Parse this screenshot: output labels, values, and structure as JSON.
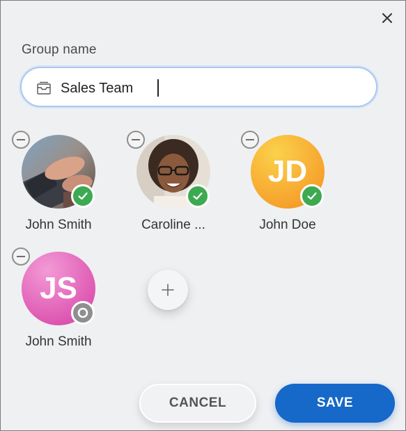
{
  "dialog": {
    "close_icon": "close-icon",
    "group_name_label": "Group name",
    "group_name_value": "Sales Team",
    "group_name_icon": "group-inbox-icon"
  },
  "members": [
    {
      "name": "John Smith",
      "avatar": "photo",
      "status": "accepted",
      "status_icon": "check-icon"
    },
    {
      "name": "Caroline ...",
      "avatar": "photo",
      "status": "accepted",
      "status_icon": "check-icon"
    },
    {
      "name": "John Doe",
      "avatar": "initials",
      "initials": "JD",
      "color": "#f7a836",
      "status": "accepted",
      "status_icon": "check-icon"
    },
    {
      "name": "John Smith",
      "avatar": "initials",
      "initials": "JS",
      "color": "#d94aa8",
      "status": "pending",
      "status_icon": "pending-icon"
    }
  ],
  "add_member_icon": "plus-icon",
  "actions": {
    "cancel_label": "CANCEL",
    "save_label": "SAVE"
  },
  "colors": {
    "accent": "#1668c9",
    "check": "#3daa52",
    "pending": "#8f8f8f",
    "background": "#eff0f2"
  }
}
